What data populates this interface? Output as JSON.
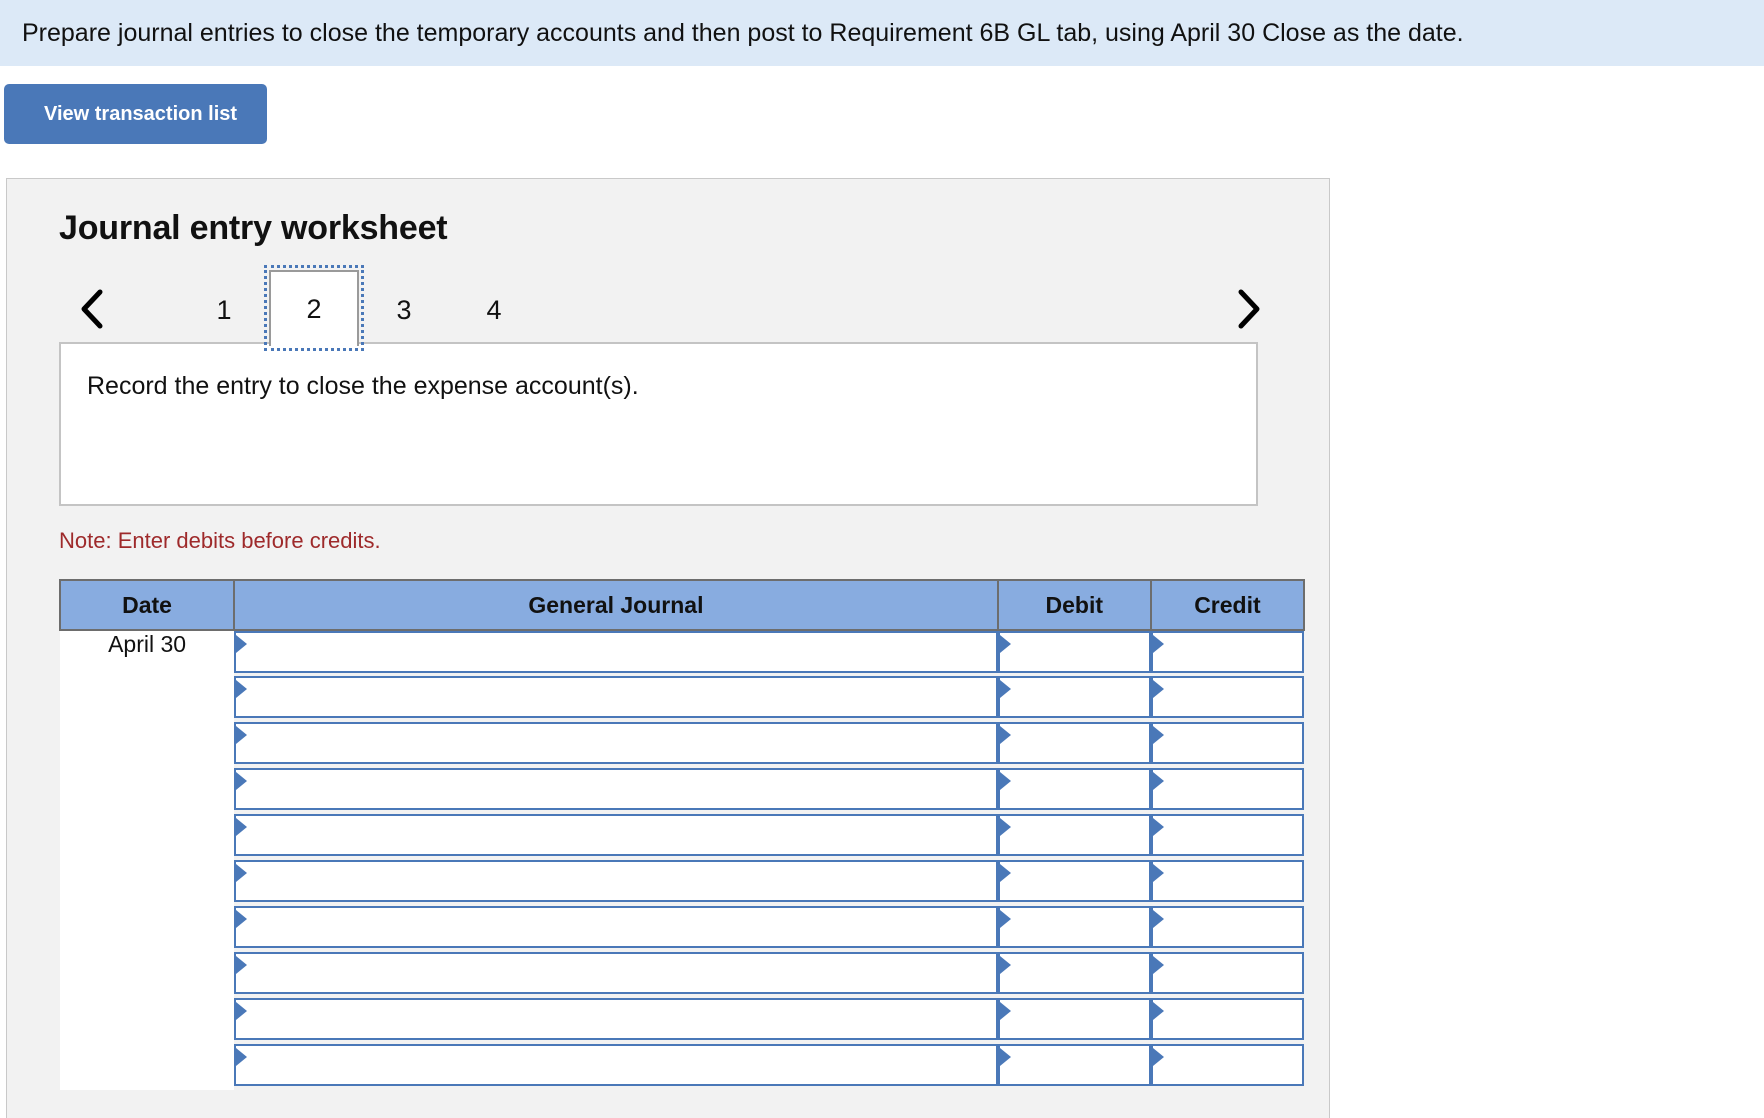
{
  "banner": {
    "instruction": "Prepare journal entries to close the temporary accounts and then post to Requirement 6B GL tab, using April 30 Close as the date."
  },
  "toolbar": {
    "view_transaction_list_label": "View transaction list"
  },
  "worksheet": {
    "title": "Journal entry worksheet",
    "pager": {
      "prev_icon": "chevron-left-icon",
      "next_icon": "chevron-right-icon",
      "tabs": [
        "1",
        "2",
        "3",
        "4"
      ],
      "active_tab": "2"
    },
    "description": "Record the entry to close the expense account(s).",
    "note": "Note: Enter debits before credits."
  },
  "table": {
    "columns": [
      "Date",
      "General Journal",
      "Debit",
      "Credit"
    ],
    "rows": [
      {
        "date": "April 30",
        "general_journal": "",
        "debit": "",
        "credit": ""
      },
      {
        "date": "",
        "general_journal": "",
        "debit": "",
        "credit": ""
      },
      {
        "date": "",
        "general_journal": "",
        "debit": "",
        "credit": ""
      },
      {
        "date": "",
        "general_journal": "",
        "debit": "",
        "credit": ""
      },
      {
        "date": "",
        "general_journal": "",
        "debit": "",
        "credit": ""
      },
      {
        "date": "",
        "general_journal": "",
        "debit": "",
        "credit": ""
      },
      {
        "date": "",
        "general_journal": "",
        "debit": "",
        "credit": ""
      },
      {
        "date": "",
        "general_journal": "",
        "debit": "",
        "credit": ""
      },
      {
        "date": "",
        "general_journal": "",
        "debit": "",
        "credit": ""
      },
      {
        "date": "",
        "general_journal": "",
        "debit": "",
        "credit": ""
      }
    ]
  },
  "colors": {
    "banner_bg": "#dce9f7",
    "button_bg": "#4a78b8",
    "panel_bg": "#f2f2f2",
    "table_header_bg": "#88ace0",
    "select_border": "#4a78b8",
    "note_color": "#9e2a2b"
  }
}
